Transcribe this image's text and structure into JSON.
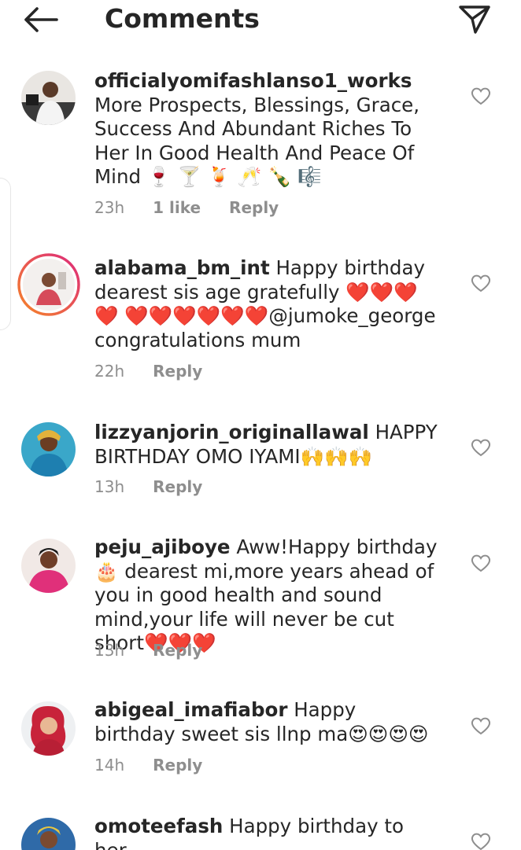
{
  "header": {
    "title": "Comments"
  },
  "comments": [
    {
      "username": "officialyomifashlanso1_works",
      "text": " More Prospects, Blessings, Grace, Success And Abundant Riches To Her In Good Health And Peace Of Mind 🍷 🍸 🍹 🥂 🍾 🎼",
      "time": "23h",
      "likes": "1 like",
      "reply": "Reply"
    },
    {
      "username": "alabama_bm_int",
      "text": " Happy birthday dearest sis age gratefully ❤️❤️❤️❤️ ❤️❤️❤️❤️❤️❤️@jumoke_george congratulations mum",
      "time": "22h",
      "reply": "Reply"
    },
    {
      "username": "lizzyanjorin_originallawal",
      "text": " HAPPY BIRTHDAY OMO IYAMI🙌🙌🙌",
      "time": "13h",
      "reply": "Reply"
    },
    {
      "username": "peju_ajiboye",
      "text": " Aww!Happy birthday 🎂 dearest mi,more years ahead of you in good health and sound mind,your life will never be cut short❤️❤️❤️",
      "time": "13h",
      "reply": "Reply"
    },
    {
      "username": "abigeal_imafiabor",
      "text": " Happy birthday sweet sis llnp ma😍😍😍😍",
      "time": "14h",
      "reply": "Reply"
    },
    {
      "username": "omoteefash",
      "text": " Happy birthday to her"
    }
  ],
  "colors": {
    "text": "#262626",
    "meta": "#8e8e8e",
    "heart": "#8e8e8e",
    "story_ring_a": "#f58529",
    "story_ring_b": "#dd2a7b"
  },
  "icons": {
    "back": "arrow-left-icon",
    "send": "paper-plane-icon",
    "like": "heart-outline-icon"
  }
}
